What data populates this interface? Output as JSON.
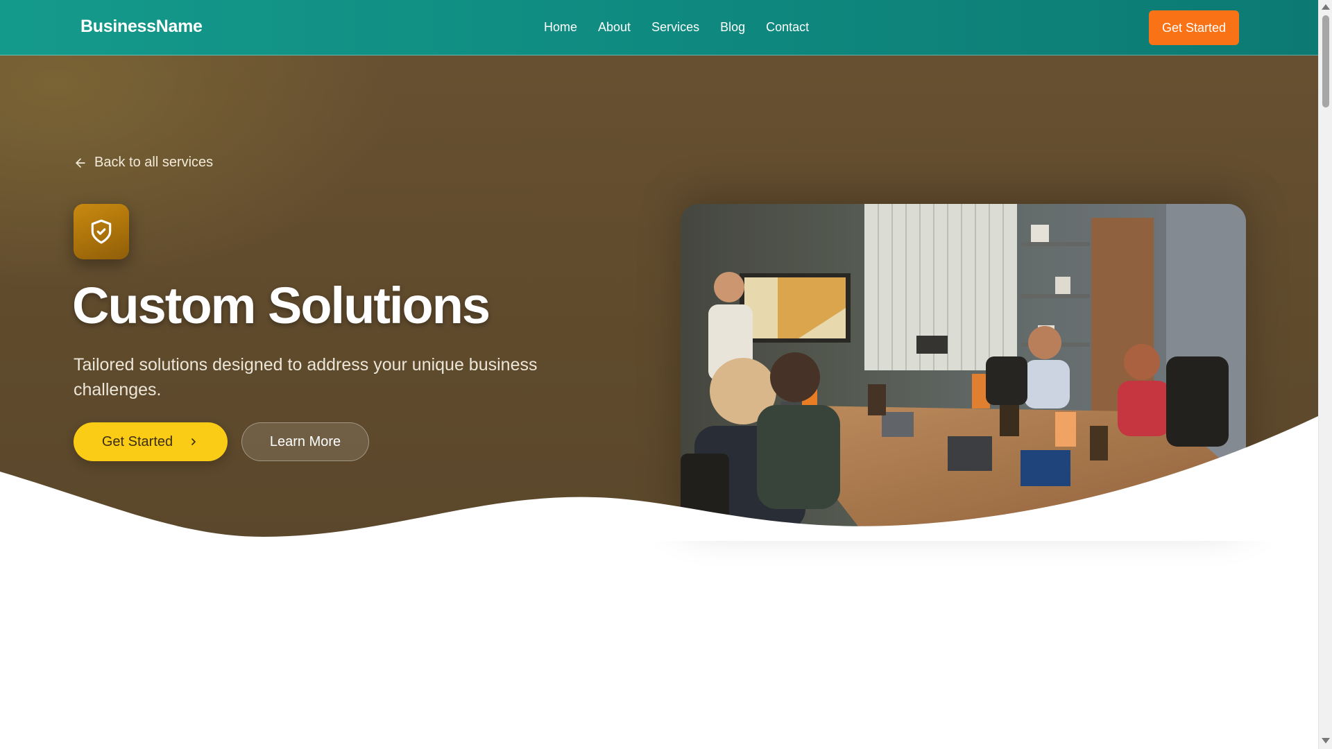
{
  "nav": {
    "brand": "BusinessName",
    "links": [
      "Home",
      "About",
      "Services",
      "Blog",
      "Contact"
    ],
    "cta_label": "Get Started"
  },
  "hero": {
    "back_label": "Back to all services",
    "icon": "shield-check-icon",
    "title": "Custom Solutions",
    "subtitle": "Tailored solutions designed to address your unique business challenges.",
    "primary_label": "Get Started",
    "secondary_label": "Learn More"
  },
  "colors": {
    "nav_bg": "#138f84",
    "cta_orange": "#f97316",
    "hero_bg": "#5f4a2c",
    "primary_yellow": "#facc15",
    "icon_gold": "#b57a0c"
  }
}
